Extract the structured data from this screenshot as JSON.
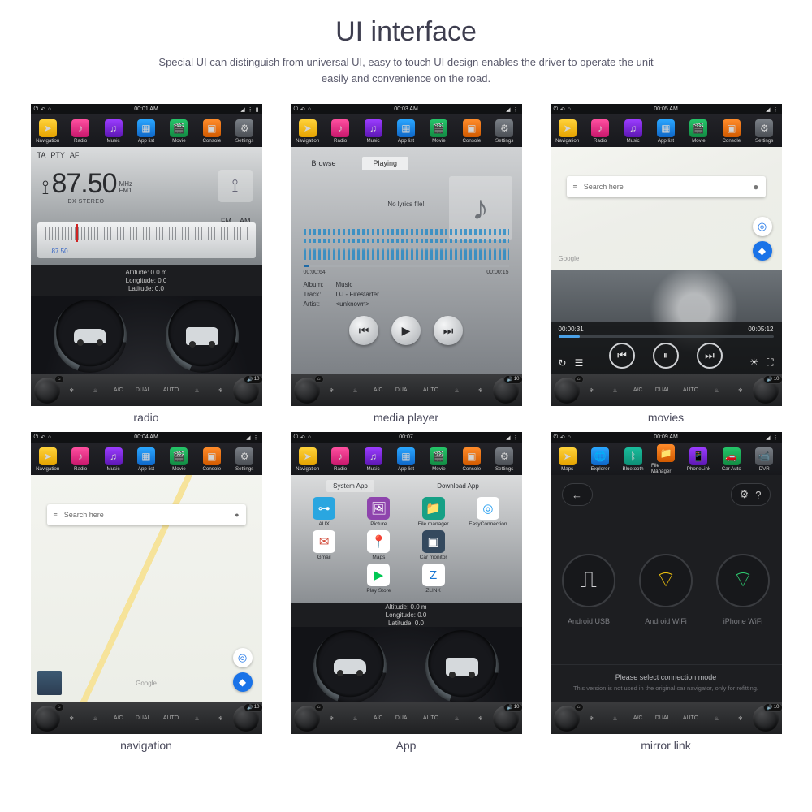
{
  "page": {
    "title": "UI interface",
    "subtitle": "Special UI can distinguish from universal UI, easy to touch UI design enables the driver to operate the unit easily and convenience on the road."
  },
  "captions": {
    "radio": "radio",
    "media": "media player",
    "movies": "movies",
    "nav": "navigation",
    "app": "App",
    "mirror": "mirror link"
  },
  "menubar": {
    "standard": [
      "Navigation",
      "Radio",
      "Music",
      "App list",
      "Movie",
      "Console",
      "Settings"
    ],
    "mirror": [
      "Maps",
      "Explorer",
      "Bluetooth",
      "File Manager",
      "PhoneLink",
      "Car Auto",
      "DVR"
    ]
  },
  "status": {
    "t_radio": "00:01 AM",
    "t_media": "00:03 AM",
    "t_movies": "00:05 AM",
    "t_nav": "00:04 AM",
    "t_app": "00:07",
    "t_mirror": "00:09 AM"
  },
  "dock": {
    "vol": "10"
  },
  "radio": {
    "tabs": [
      "TA",
      "PTY",
      "AF"
    ],
    "freq": "87.50",
    "unit_top": "MHz",
    "unit_bot": "FM1",
    "stereo": "DX  STEREO",
    "bands": [
      "FM",
      "AM"
    ],
    "tune_val": "87.50"
  },
  "gps": {
    "alt": "Altitude:   0.0  m",
    "lon": "Longitude:   0.0",
    "lat": "Latitude:   0.0"
  },
  "media": {
    "tab_browse": "Browse",
    "tab_playing": "Playing",
    "nolyrics": "No lyrics file!",
    "t_start": "00:00:64",
    "t_end": "00:00:15",
    "k_album": "Album:",
    "v_album": "Music",
    "k_track": "Track:",
    "v_track": "DJ - Firestarter",
    "k_artist": "Artist:",
    "v_artist": "<unknown>"
  },
  "movies": {
    "search_ph": "Search here",
    "google": "Google",
    "cur": "00:00:31",
    "dur": "00:05:12"
  },
  "nav": {
    "search_ph": "Search here",
    "google": "Google"
  },
  "app": {
    "tab1": "System App",
    "tab2": "Download App",
    "row1": [
      "AUX",
      "Picture",
      "File manager",
      "EasyConnection",
      "Gmail",
      "Maps"
    ],
    "row2": [
      "Car monitor",
      "",
      "",
      "Play Store",
      "ZLINK",
      ""
    ]
  },
  "mirror": {
    "usb": "Android USB",
    "awifi": "Android WiFi",
    "iwifi": "iPhone WiFi",
    "foot1": "Please select connection mode",
    "foot2": "This version is not used in the original car navigator, only for refitting."
  }
}
